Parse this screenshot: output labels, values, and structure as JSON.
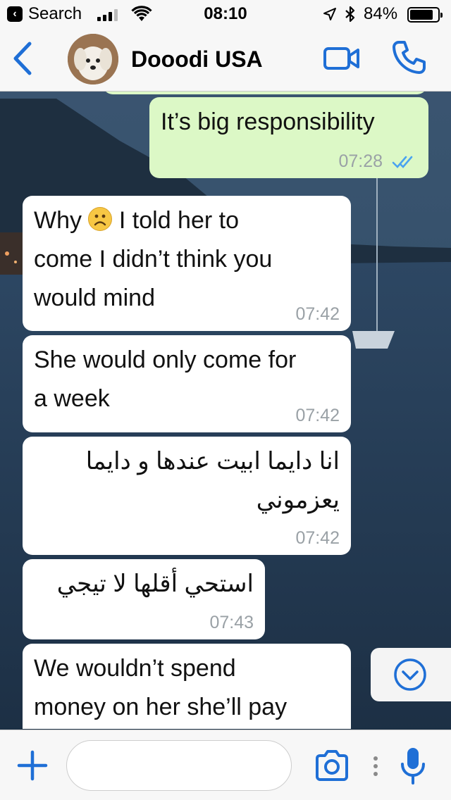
{
  "status_bar": {
    "back_app": "Search",
    "time": "08:10",
    "battery_percent": "84%",
    "battery_level": 0.84,
    "signal_bars": 3
  },
  "header": {
    "contact_name": "Dooodi USA",
    "avatar_icon": "dog-avatar"
  },
  "messages": [
    {
      "direction": "outgoing",
      "text": "It’s big responsibility",
      "time": "07:28",
      "status": "read"
    },
    {
      "direction": "incoming",
      "text_before_emoji": "Why ",
      "emoji": "frowning-face",
      "text_after_emoji": " I told her to\ncome I didn’t think you\nwould mind",
      "time": "07:42"
    },
    {
      "direction": "incoming",
      "text": "She would only come for\na week",
      "time": "07:42"
    },
    {
      "direction": "incoming",
      "text": "انا دايما ابيت عندها و دايما\nيعزموني",
      "time": "07:42"
    },
    {
      "direction": "incoming",
      "text": "استحي أقلها لا تيجي",
      "time": "07:43"
    },
    {
      "direction": "incoming",
      "text": "We wouldn’t spend\nmoney on her she’ll pay",
      "time": ""
    }
  ],
  "input": {
    "placeholder": "",
    "value": ""
  },
  "colors": {
    "accent": "#1f6fd6",
    "outgoing_bubble": "#dcf8c6",
    "incoming_bubble": "#ffffff",
    "read_ticks": "#4aa3f0"
  }
}
